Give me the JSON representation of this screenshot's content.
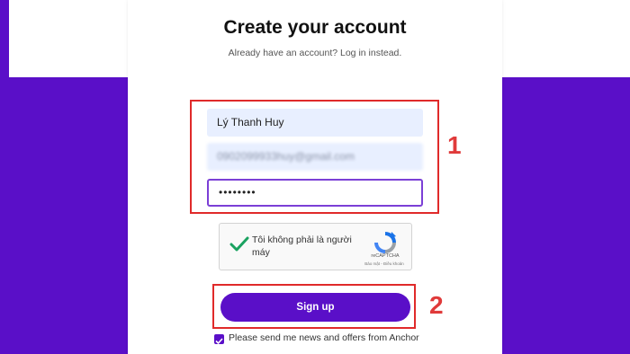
{
  "header": {
    "title": "Create your account",
    "subtitle": "Already have an account? Log in instead."
  },
  "form": {
    "name_value": "Lý Thanh Huy",
    "email_value": "0902099933huy@gmail.com",
    "password_value": "••••••••"
  },
  "captcha": {
    "label": "Tôi không phải là người máy",
    "brand": "reCAPTCHA",
    "privacy": "Bảo mật - Điều khoản",
    "checked": true
  },
  "signup": {
    "label": "Sign up"
  },
  "newsletter": {
    "label": "Please send me news and offers from Anchor",
    "checked": true
  },
  "annotations": [
    "1",
    "2"
  ],
  "colors": {
    "brand": "#5a0fc8",
    "annotation": "#e02a2a",
    "input_fill": "#e8efff",
    "check": "#1aa260"
  }
}
